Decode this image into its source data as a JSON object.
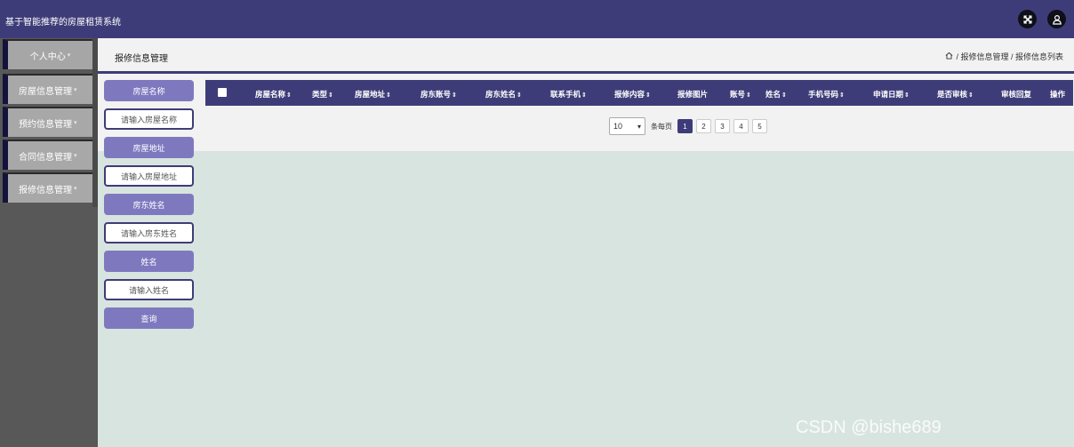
{
  "app": {
    "title": "基于智能推荐的房屋租赁系统"
  },
  "header": {
    "icons": [
      "close-fullscreen-icon",
      "user-icon"
    ]
  },
  "sidebar": {
    "items": [
      {
        "label": "个人中心"
      },
      {
        "label": "房屋信息管理"
      },
      {
        "label": "预约信息管理"
      },
      {
        "label": "合同信息管理"
      },
      {
        "label": "报修信息管理"
      }
    ]
  },
  "breadcrumb": {
    "page_title": "报修信息管理",
    "path": "/ 报修信息管理 / 报修信息列表"
  },
  "search": {
    "fields": [
      {
        "label": "房屋名称",
        "placeholder": "请输入房屋名称"
      },
      {
        "label": "房屋地址",
        "placeholder": "请输入房屋地址"
      },
      {
        "label": "房东姓名",
        "placeholder": "请输入房东姓名"
      },
      {
        "label": "姓名",
        "placeholder": "请输入姓名"
      }
    ],
    "query_button": "查询"
  },
  "table": {
    "columns": [
      {
        "label": "房屋名称",
        "sortable": true
      },
      {
        "label": "类型",
        "sortable": true
      },
      {
        "label": "房屋地址",
        "sortable": true
      },
      {
        "label": "房东账号",
        "sortable": true
      },
      {
        "label": "房东姓名",
        "sortable": true
      },
      {
        "label": "联系手机",
        "sortable": true
      },
      {
        "label": "报修内容",
        "sortable": true
      },
      {
        "label": "报修图片",
        "sortable": false
      },
      {
        "label": "账号",
        "sortable": true
      },
      {
        "label": "姓名",
        "sortable": true
      },
      {
        "label": "手机号码",
        "sortable": true
      },
      {
        "label": "申请日期",
        "sortable": true
      },
      {
        "label": "是否审核",
        "sortable": true
      },
      {
        "label": "审核回复",
        "sortable": false
      },
      {
        "label": "操作",
        "sortable": false
      }
    ]
  },
  "pagination": {
    "page_size": "10",
    "per_page_label": "条每页",
    "pages": [
      "1",
      "2",
      "3",
      "4",
      "5"
    ],
    "current": "1"
  },
  "watermark": "CSDN @bishe689"
}
